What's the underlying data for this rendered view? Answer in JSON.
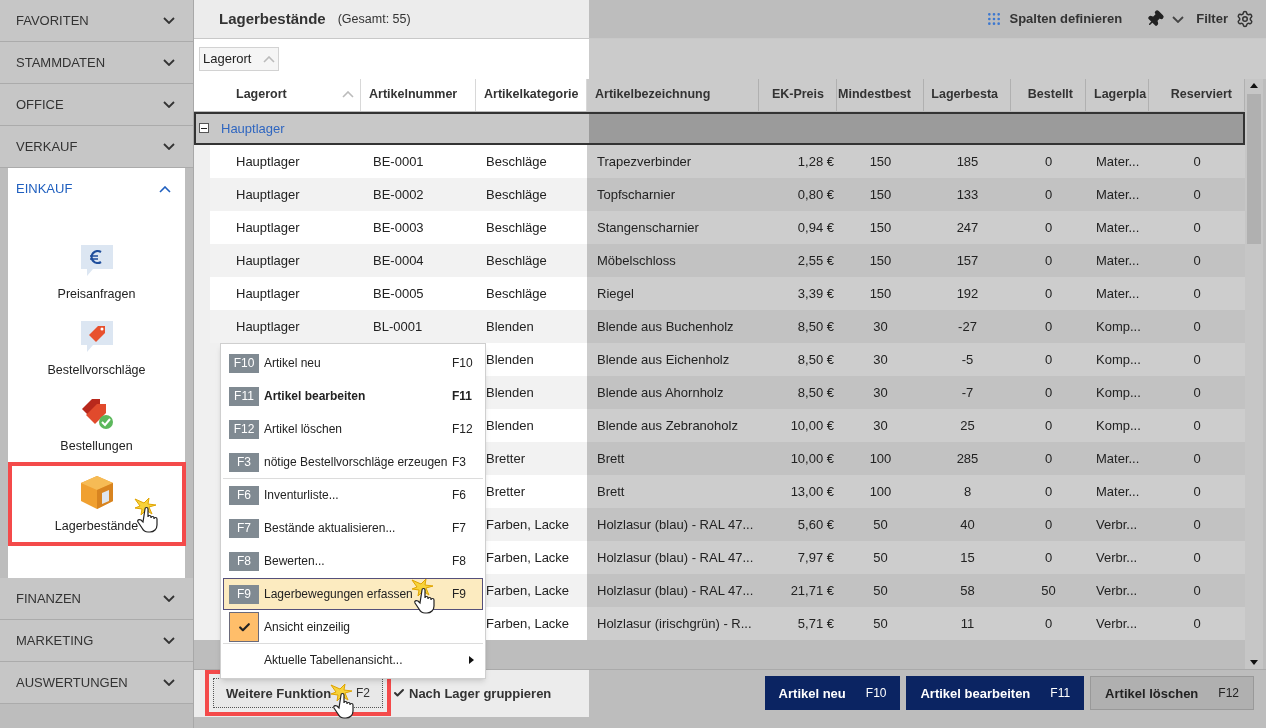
{
  "sidebar": {
    "sections": [
      {
        "label": "FAVORITEN",
        "expanded": false
      },
      {
        "label": "STAMMDATEN",
        "expanded": false
      },
      {
        "label": "OFFICE",
        "expanded": false
      },
      {
        "label": "VERKAUF",
        "expanded": false
      },
      {
        "label": "EINKAUF",
        "expanded": true,
        "items": [
          {
            "label": "Preisanfragen",
            "highlighted": false
          },
          {
            "label": "Bestellvorschläge",
            "highlighted": false
          },
          {
            "label": "Bestellungen",
            "highlighted": false
          },
          {
            "label": "Lagerbestände",
            "highlighted": true
          }
        ]
      },
      {
        "label": "FINANZEN",
        "expanded": false
      },
      {
        "label": "MARKETING",
        "expanded": false
      },
      {
        "label": "AUSWERTUNGEN",
        "expanded": false
      }
    ]
  },
  "header": {
    "title": "Lagerbestände",
    "total": "(Gesamt: 55)",
    "columns_action": "Spalten definieren",
    "filter": "Filter"
  },
  "group_chip": "Lagerort",
  "table": {
    "columns": [
      {
        "label": "Lagerort",
        "sorted": true
      },
      {
        "label": "Artikelnummer"
      },
      {
        "label": "Artikelkategorie"
      },
      {
        "label": "Artikelbezeichnung"
      },
      {
        "label": "EK-Preis"
      },
      {
        "label": "Mindestbest"
      },
      {
        "label": "Lagerbesta"
      },
      {
        "label": "Bestellt"
      },
      {
        "label": "Lagerpla"
      },
      {
        "label": "Reserviert"
      }
    ],
    "group": {
      "label": "Hauptlager",
      "expanded": true
    },
    "rows": [
      {
        "cells": [
          "Hauptlager",
          "BE-0001",
          "Beschläge",
          "Trapezverbinder",
          "1,28 €",
          "150",
          "185",
          "0",
          "Mater...",
          "0"
        ]
      },
      {
        "cells": [
          "Hauptlager",
          "BE-0002",
          "Beschläge",
          "Topfscharnier",
          "0,80 €",
          "150",
          "133",
          "0",
          "Mater...",
          "0"
        ]
      },
      {
        "cells": [
          "Hauptlager",
          "BE-0003",
          "Beschläge",
          "Stangenscharnier",
          "0,94 €",
          "150",
          "247",
          "0",
          "Mater...",
          "0"
        ]
      },
      {
        "cells": [
          "Hauptlager",
          "BE-0004",
          "Beschläge",
          "Möbelschloss",
          "2,55 €",
          "150",
          "157",
          "0",
          "Mater...",
          "0"
        ]
      },
      {
        "cells": [
          "Hauptlager",
          "BE-0005",
          "Beschläge",
          "Riegel",
          "3,39 €",
          "150",
          "192",
          "0",
          "Mater...",
          "0"
        ]
      },
      {
        "cells": [
          "Hauptlager",
          "BL-0001",
          "Blenden",
          "Blende aus Buchenholz",
          "8,50 €",
          "30",
          "-27",
          "0",
          "Komp...",
          "0"
        ]
      },
      {
        "cells": [
          "",
          "",
          "Blenden",
          "Blende aus Eichenholz",
          "8,50 €",
          "30",
          "-5",
          "0",
          "Komp...",
          "0"
        ]
      },
      {
        "cells": [
          "",
          "",
          "Blenden",
          "Blende aus Ahornholz",
          "8,50 €",
          "30",
          "-7",
          "0",
          "Komp...",
          "0"
        ]
      },
      {
        "cells": [
          "",
          "",
          "Blenden",
          "Blende aus Zebranoholz",
          "10,00 €",
          "30",
          "25",
          "0",
          "Komp...",
          "0"
        ]
      },
      {
        "cells": [
          "",
          "",
          "Bretter",
          "Brett",
          "10,00 €",
          "100",
          "285",
          "0",
          "Mater...",
          "0"
        ]
      },
      {
        "cells": [
          "",
          "",
          "Bretter",
          "Brett",
          "13,00 €",
          "100",
          "8",
          "0",
          "Mater...",
          "0"
        ]
      },
      {
        "cells": [
          "",
          "",
          "Farben, Lacke",
          "Holzlasur (blau) - RAL 47...",
          "5,60 €",
          "50",
          "40",
          "0",
          "Verbr...",
          "0"
        ]
      },
      {
        "cells": [
          "",
          "",
          "Farben, Lacke",
          "Holzlasur (blau) - RAL 47...",
          "7,97 €",
          "50",
          "15",
          "0",
          "Verbr...",
          "0"
        ]
      },
      {
        "cells": [
          "",
          "",
          "Farben, Lacke",
          "Holzlasur (blau) - RAL 47...",
          "21,71 €",
          "50",
          "58",
          "50",
          "Verbr...",
          "0"
        ]
      },
      {
        "cells": [
          "",
          "",
          "Farben, Lacke",
          "Holzlasur (irischgrün) - R...",
          "5,71 €",
          "50",
          "11",
          "0",
          "Verbr...",
          "0"
        ]
      }
    ]
  },
  "menu": {
    "items": [
      {
        "kind": "command",
        "badge": "F10",
        "label": "Artikel neu",
        "shortcut": "F10",
        "bold": false,
        "selected": false,
        "separator_before": false
      },
      {
        "kind": "command",
        "badge": "F11",
        "label": "Artikel bearbeiten",
        "shortcut": "F11",
        "bold": true,
        "selected": false,
        "separator_before": false
      },
      {
        "kind": "command",
        "badge": "F12",
        "label": "Artikel löschen",
        "shortcut": "F12",
        "bold": false,
        "selected": false,
        "separator_before": false
      },
      {
        "kind": "command",
        "badge": "F3",
        "label": "nötige Bestellvorschläge erzeugen",
        "shortcut": "F3",
        "bold": false,
        "selected": false,
        "separator_before": false
      },
      {
        "kind": "command",
        "badge": "F6",
        "label": "Inventurliste...",
        "shortcut": "F6",
        "bold": false,
        "selected": false,
        "separator_before": true
      },
      {
        "kind": "command",
        "badge": "F7",
        "label": "Bestände aktualisieren...",
        "shortcut": "F7",
        "bold": false,
        "selected": false,
        "separator_before": false
      },
      {
        "kind": "command",
        "badge": "F8",
        "label": "Bewerten...",
        "shortcut": "F8",
        "bold": false,
        "selected": false,
        "separator_before": false
      },
      {
        "kind": "command",
        "badge": "F9",
        "label": "Lagerbewegungen erfassen",
        "shortcut": "F9",
        "bold": false,
        "selected": true,
        "separator_before": false
      },
      {
        "kind": "toggle",
        "label": "Ansicht einzeilig",
        "checked": true,
        "selected": false,
        "separator_before": false
      },
      {
        "kind": "submenu",
        "label": "Aktuelle Tabellenansicht...",
        "selected": false,
        "separator_before": true
      }
    ]
  },
  "footer": {
    "more_button": {
      "label": "Weitere Funktion",
      "shortcut": "F2",
      "highlighted": true
    },
    "group_checkbox": {
      "label": "Nach Lager gruppieren",
      "checked": true
    },
    "buttons": [
      {
        "kind": "primary",
        "label": "Artikel neu",
        "shortcut": "F10"
      },
      {
        "kind": "primary",
        "label": "Artikel bearbeiten",
        "shortcut": "F11"
      },
      {
        "kind": "secondary",
        "label": "Artikel löschen",
        "shortcut": "F12"
      }
    ]
  }
}
